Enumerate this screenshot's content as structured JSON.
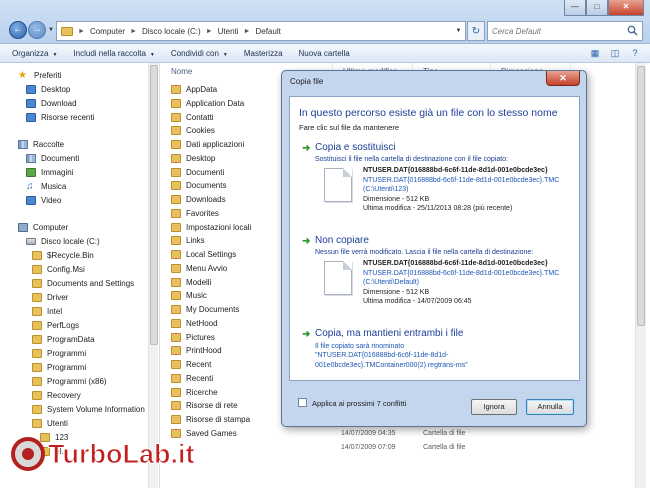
{
  "titlebar": {
    "breadcrumb": [
      "Computer",
      "Disco locale (C:)",
      "Utenti",
      "Default"
    ],
    "search_placeholder": "Cerca Default"
  },
  "toolbar": {
    "organize": "Organizza",
    "include": "Includi nella raccolta",
    "share": "Condividi con",
    "burn": "Masterizza",
    "new_folder": "Nuova cartella"
  },
  "navpane": {
    "favorites": "Preferiti",
    "desktop": "Desktop",
    "download": "Download",
    "recent": "Risorse recenti",
    "libraries": "Raccolte",
    "documents": "Documenti",
    "images": "Immagini",
    "music": "Musica",
    "video": "Video",
    "computer": "Computer",
    "disk": "Disco locale (C:)",
    "folders": [
      "$Recycle.Bin",
      "Config.Msi",
      "Documents and Settings",
      "Driver",
      "Intel",
      "PerfLogs",
      "ProgramData",
      "Programmi",
      "Programmi",
      "Programmi (x86)",
      "Recovery",
      "System Volume Information",
      "Utenti",
      "123",
      "el..."
    ]
  },
  "filelist": {
    "columns": [
      "Nome",
      "Ultima modifica",
      "Tipo",
      "Dimensione"
    ],
    "items": [
      "AppData",
      "Application Data",
      "Contatti",
      "Cookies",
      "Dati applicazioni",
      "Desktop",
      "Documenti",
      "Documents",
      "Downloads",
      "Favorites",
      "Impostazioni locali",
      "Links",
      "Local Settings",
      "Menu Avvio",
      "Modelli",
      "Music",
      "My Documents",
      "NetHood",
      "Pictures",
      "PrintHood",
      "Recent",
      "Recenti",
      "Ricerche",
      "Risorse di rete",
      "Risorse di stampa",
      "Saved Games"
    ],
    "bottom_rows": [
      {
        "date": "14/07/2009 04:35",
        "type": "Cartella di file"
      },
      {
        "date": "14/07/2009 07:09",
        "type": "Cartella di file"
      }
    ]
  },
  "dialog": {
    "title": "Copia file",
    "heading": "In questo percorso esiste già un file con lo stesso nome",
    "subheading": "Fare clic sul file da mantenere",
    "replace": {
      "title": "Copia e sostituisci",
      "desc": "Sostituisci il file nella cartella di destinazione con il file copiato:",
      "name": "NTUSER.DAT{016888bd-6c6f-11de-8d1d-001e0bcde3ec}",
      "longname": "NTUSER.DAT{016888bd-6c6f-11de-8d1d-001e0bcde3ec}.TMC",
      "path": "(C:\\Utenti\\123)",
      "size": "Dimensione - 512 KB",
      "modified": "Ultima modifica - 25/11/2013 08:28 (più recente)"
    },
    "skip": {
      "title": "Non copiare",
      "desc": "Nessun file verrà modificato. Lascia il file nella cartella di destinazione:",
      "name": "NTUSER.DAT{016888bd-6c6f-11de-8d1d-001e0bcde3ec}",
      "longname": "NTUSER.DAT{016888bd-6c6f-11de-8d1d-001e0bcde3ec}.TMC",
      "path": "(C:\\Utenti\\Default)",
      "size": "Dimensione - 512 KB",
      "modified": "Ultima modifica - 14/07/2009 06:45"
    },
    "keep_both": {
      "title": "Copia, ma mantieni entrambi i file",
      "desc": "Il file copiato sarà rinominato",
      "newname": "\"NTUSER.DAT{016888bd-6c6f-11de-8d1d-001e0bcde3ec}.TMContainer000(2).regtrans-ms\""
    },
    "apply_label": "Applica ai prossimi 7 conflitti",
    "ignore": "Ignora",
    "cancel": "Annulla"
  },
  "watermark": "TurboLab.it"
}
